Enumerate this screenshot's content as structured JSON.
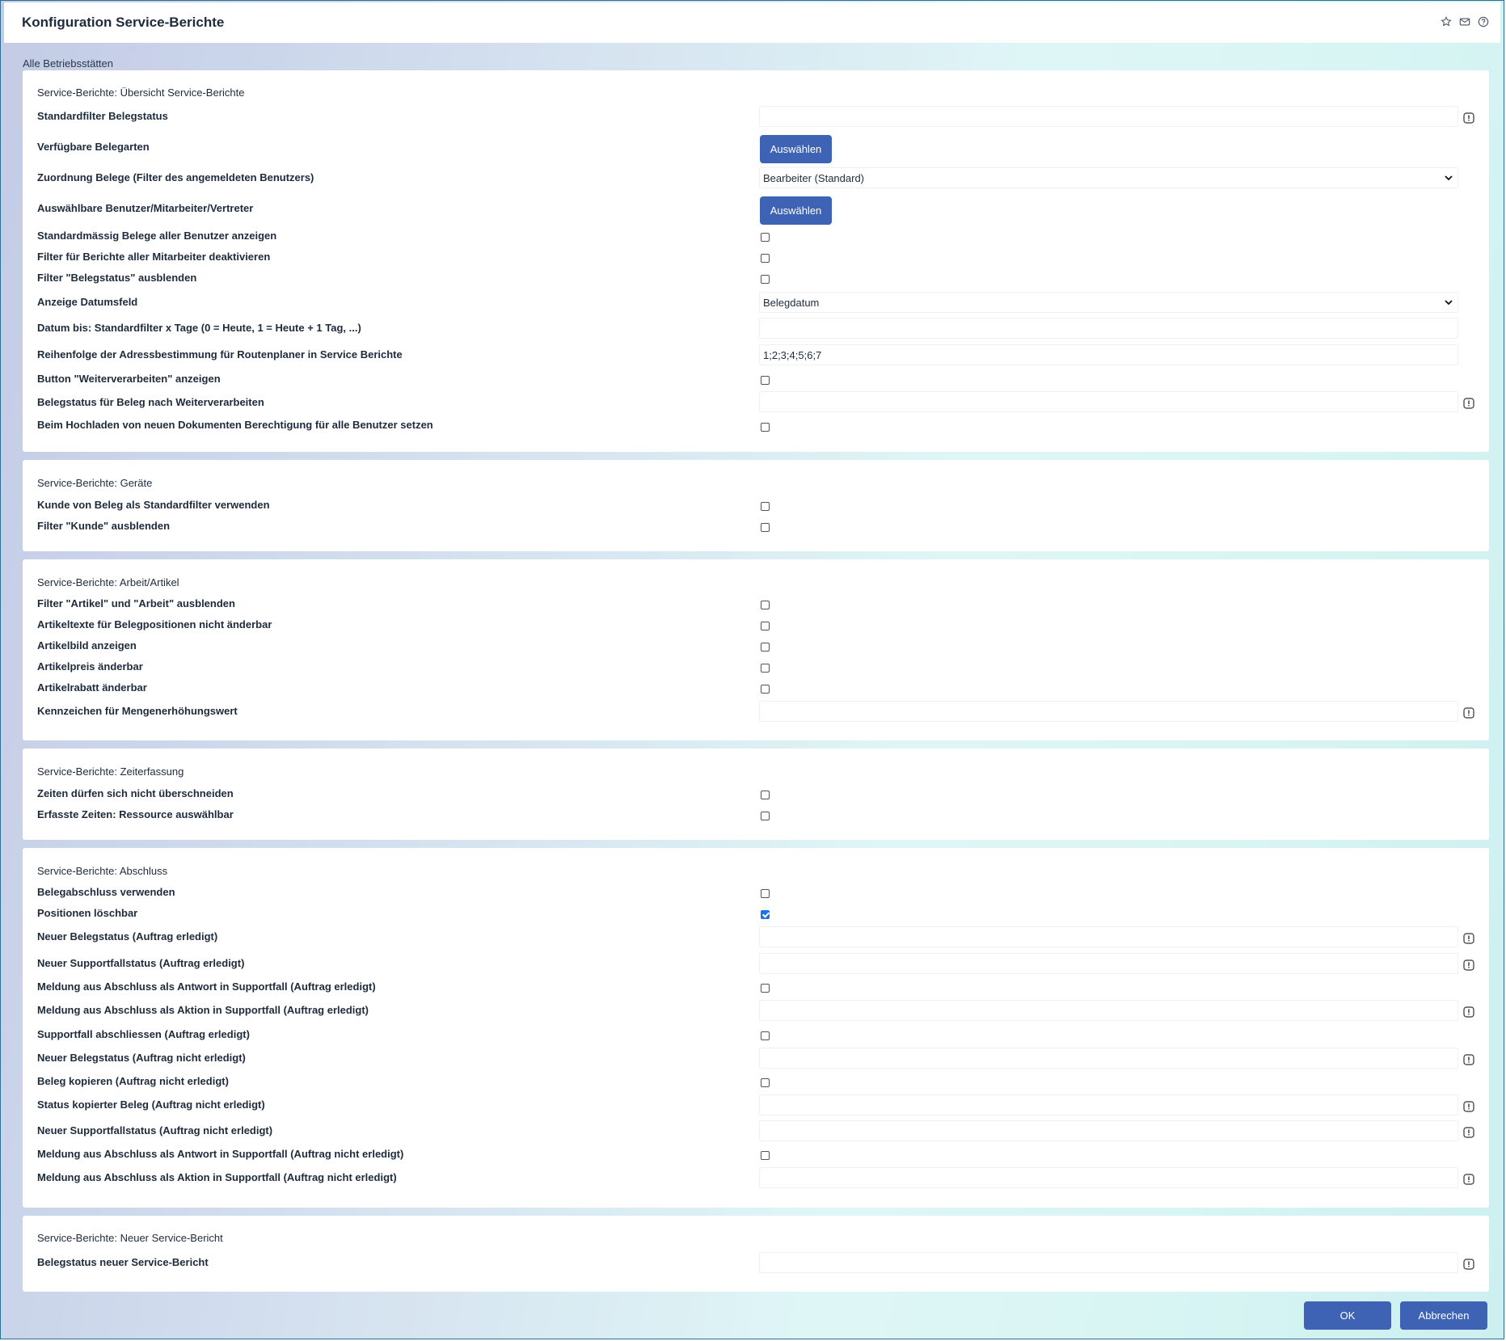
{
  "window": {
    "title": "Konfiguration Service-Berichte"
  },
  "scope": "Alle Betriebsstätten",
  "buttons": {
    "select": "Auswählen",
    "ok": "OK",
    "cancel": "Abbrechen"
  },
  "s1": {
    "head": "Service-Berichte: Übersicht Service-Berichte",
    "r1": "Standardfilter Belegstatus",
    "r2": "Verfügbare Belegarten",
    "r3": "Zuordnung Belege (Filter des angemeldeten Benutzers)",
    "r3_value": "Bearbeiter (Standard)",
    "r4": "Auswählbare Benutzer/Mitarbeiter/Vertreter",
    "r5": "Standardmässig Belege aller Benutzer anzeigen",
    "r6": "Filter für Berichte aller Mitarbeiter deaktivieren",
    "r7": "Filter \"Belegstatus\" ausblenden",
    "r8": "Anzeige Datumsfeld",
    "r8_value": "Belegdatum",
    "r9": "Datum bis: Standardfilter x Tage (0 = Heute, 1 = Heute + 1 Tag, ...)",
    "r10": "Reihenfolge der Adressbestimmung für Routenplaner in Service Berichte",
    "r10_value": "1;2;3;4;5;6;7",
    "r11": "Button \"Weiterverarbeiten\" anzeigen",
    "r12": "Belegstatus für Beleg nach Weiterverarbeiten",
    "r13": "Beim Hochladen von neuen Dokumenten Berechtigung für alle Benutzer setzen"
  },
  "s2": {
    "head": "Service-Berichte: Geräte",
    "r1": "Kunde von Beleg als Standardfilter verwenden",
    "r2": "Filter \"Kunde\" ausblenden"
  },
  "s3": {
    "head": "Service-Berichte: Arbeit/Artikel",
    "r1": "Filter \"Artikel\" und \"Arbeit\" ausblenden",
    "r2": "Artikeltexte für Belegpositionen nicht änderbar",
    "r3": "Artikelbild anzeigen",
    "r4": "Artikelpreis änderbar",
    "r5": "Artikelrabatt änderbar",
    "r6": "Kennzeichen für Mengenerhöhungswert"
  },
  "s4": {
    "head": "Service-Berichte: Zeiterfassung",
    "r1": "Zeiten dürfen sich nicht überschneiden",
    "r2": "Erfasste Zeiten: Ressource auswählbar"
  },
  "s5": {
    "head": "Service-Berichte: Abschluss",
    "r1": "Belegabschluss verwenden",
    "r2": "Positionen löschbar",
    "r2_checked": true,
    "r3": "Neuer Belegstatus (Auftrag erledigt)",
    "r4": "Neuer Supportfallstatus (Auftrag erledigt)",
    "r5": "Meldung aus Abschluss als Antwort in Supportfall (Auftrag erledigt)",
    "r6": "Meldung aus Abschluss als Aktion in Supportfall (Auftrag erledigt)",
    "r7": "Supportfall abschliessen (Auftrag erledigt)",
    "r8": "Neuer Belegstatus (Auftrag nicht erledigt)",
    "r9": "Beleg kopieren (Auftrag nicht erledigt)",
    "r10": "Status kopierter Beleg (Auftrag nicht erledigt)",
    "r11": "Neuer Supportfallstatus (Auftrag nicht erledigt)",
    "r12": "Meldung aus Abschluss als Antwort in Supportfall (Auftrag nicht erledigt)",
    "r13": "Meldung aus Abschluss als Aktion in Supportfall (Auftrag nicht erledigt)"
  },
  "s6": {
    "head": "Service-Berichte: Neuer Service-Bericht",
    "r1": "Belegstatus neuer Service-Bericht"
  },
  "icons": {
    "favorite": "star-icon",
    "mail": "mail-icon",
    "help": "help-icon",
    "info": "info-icon",
    "dropdown": "chevron-down-icon"
  }
}
